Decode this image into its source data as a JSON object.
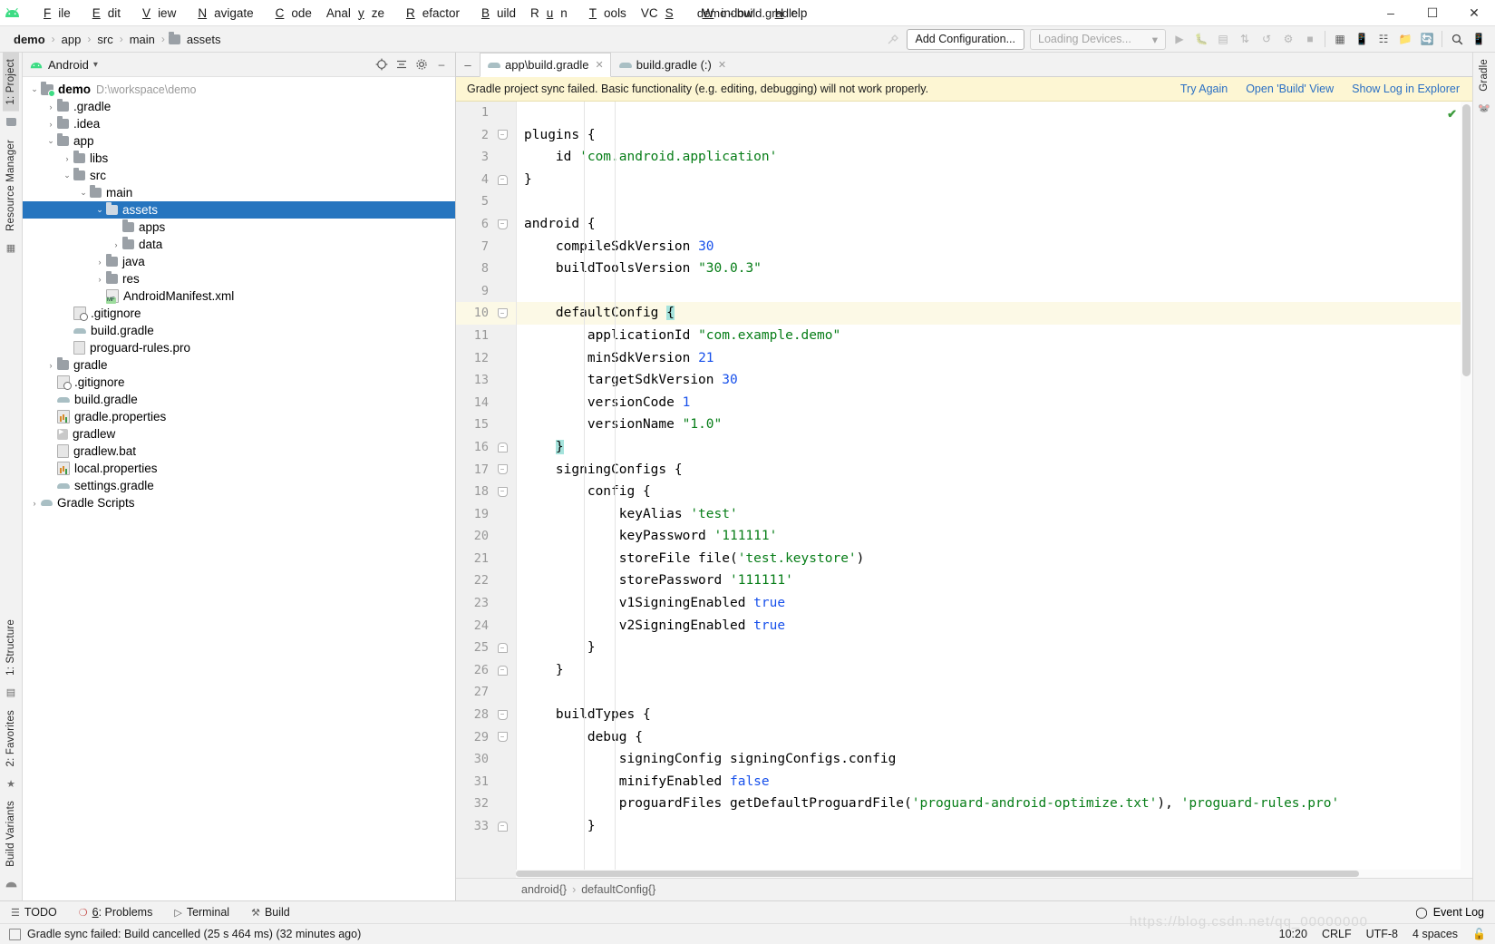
{
  "window": {
    "title": "demo - build.gradle",
    "menu": [
      "File",
      "Edit",
      "View",
      "Navigate",
      "Code",
      "Analyze",
      "Refactor",
      "Build",
      "Run",
      "Tools",
      "VCS",
      "Window",
      "Help"
    ],
    "controls": {
      "minimize": "–",
      "maximize": "☐",
      "close": "✕"
    }
  },
  "breadcrumb": {
    "items": [
      "demo",
      "app",
      "src",
      "main",
      "assets"
    ],
    "separator": "›"
  },
  "toolbar": {
    "add_configuration": "Add Configuration...",
    "devices": "Loading Devices...",
    "devices_caret": "▾"
  },
  "left_rail": {
    "top": [
      "1: Project",
      "Resource Manager"
    ],
    "bottom": [
      "1: Structure",
      "2: Favorites",
      "Build Variants"
    ]
  },
  "project_panel": {
    "title": "Android",
    "caret": "▾",
    "tree": [
      {
        "depth": 0,
        "arrow": "⌄",
        "icon": "module",
        "name": "demo",
        "bold": true,
        "path": "D:\\workspace\\demo",
        "selected": false
      },
      {
        "depth": 1,
        "arrow": "›",
        "icon": "folder",
        "name": ".gradle",
        "selected": false
      },
      {
        "depth": 1,
        "arrow": "›",
        "icon": "folder",
        "name": ".idea",
        "selected": false
      },
      {
        "depth": 1,
        "arrow": "⌄",
        "icon": "folder",
        "name": "app",
        "selected": false
      },
      {
        "depth": 2,
        "arrow": "›",
        "icon": "folder",
        "name": "libs",
        "selected": false
      },
      {
        "depth": 2,
        "arrow": "⌄",
        "icon": "folder",
        "name": "src",
        "selected": false
      },
      {
        "depth": 3,
        "arrow": "⌄",
        "icon": "folder",
        "name": "main",
        "selected": false
      },
      {
        "depth": 4,
        "arrow": "⌄",
        "icon": "folder",
        "name": "assets",
        "selected": true
      },
      {
        "depth": 5,
        "arrow": "",
        "icon": "folder",
        "name": "apps",
        "selected": false
      },
      {
        "depth": 5,
        "arrow": "›",
        "icon": "folder",
        "name": "data",
        "selected": false
      },
      {
        "depth": 4,
        "arrow": "›",
        "icon": "folder",
        "name": "java",
        "selected": false
      },
      {
        "depth": 4,
        "arrow": "›",
        "icon": "folder",
        "name": "res",
        "selected": false
      },
      {
        "depth": 4,
        "arrow": "",
        "icon": "manifest",
        "name": "AndroidManifest.xml",
        "selected": false
      },
      {
        "depth": 2,
        "arrow": "",
        "icon": "gitignore",
        "name": ".gitignore",
        "selected": false
      },
      {
        "depth": 2,
        "arrow": "",
        "icon": "gradle",
        "name": "build.gradle",
        "selected": false
      },
      {
        "depth": 2,
        "arrow": "",
        "icon": "file",
        "name": "proguard-rules.pro",
        "selected": false
      },
      {
        "depth": 1,
        "arrow": "›",
        "icon": "folder",
        "name": "gradle",
        "selected": false
      },
      {
        "depth": 1,
        "arrow": "",
        "icon": "gitignore",
        "name": ".gitignore",
        "selected": false
      },
      {
        "depth": 1,
        "arrow": "",
        "icon": "gradle",
        "name": "build.gradle",
        "selected": false
      },
      {
        "depth": 1,
        "arrow": "",
        "icon": "props",
        "name": "gradle.properties",
        "selected": false
      },
      {
        "depth": 1,
        "arrow": "",
        "icon": "exe",
        "name": "gradlew",
        "selected": false
      },
      {
        "depth": 1,
        "arrow": "",
        "icon": "file",
        "name": "gradlew.bat",
        "selected": false
      },
      {
        "depth": 1,
        "arrow": "",
        "icon": "props",
        "name": "local.properties",
        "selected": false
      },
      {
        "depth": 1,
        "arrow": "",
        "icon": "gradle",
        "name": "settings.gradle",
        "selected": false
      },
      {
        "depth": 0,
        "arrow": "›",
        "icon": "gradlescripts",
        "name": "Gradle Scripts",
        "selected": false
      }
    ]
  },
  "editor": {
    "tabs": [
      {
        "label": "app\\build.gradle",
        "active": true,
        "close": "✕"
      },
      {
        "label": "build.gradle (:)",
        "active": false,
        "close": "✕"
      }
    ],
    "notification": {
      "message": "Gradle project sync failed. Basic functionality (e.g. editing, debugging) will not work properly.",
      "links": [
        "Try Again",
        "Open 'Build' View",
        "Show Log in Explorer"
      ]
    },
    "first_line": 1,
    "highlight_line": 10,
    "lines": [
      {
        "n": 1,
        "text": ""
      },
      {
        "n": 2,
        "text": "plugins {",
        "fold": "open"
      },
      {
        "n": 3,
        "text": "    id 'com.android.application'"
      },
      {
        "n": 4,
        "text": "}",
        "fold": "end"
      },
      {
        "n": 5,
        "text": ""
      },
      {
        "n": 6,
        "text": "android {",
        "fold": "open"
      },
      {
        "n": 7,
        "text": "    compileSdkVersion 30"
      },
      {
        "n": 8,
        "text": "    buildToolsVersion \"30.0.3\""
      },
      {
        "n": 9,
        "text": ""
      },
      {
        "n": 10,
        "text": "    defaultConfig {",
        "fold": "open"
      },
      {
        "n": 11,
        "text": "        applicationId \"com.example.demo\""
      },
      {
        "n": 12,
        "text": "        minSdkVersion 21"
      },
      {
        "n": 13,
        "text": "        targetSdkVersion 30"
      },
      {
        "n": 14,
        "text": "        versionCode 1"
      },
      {
        "n": 15,
        "text": "        versionName \"1.0\""
      },
      {
        "n": 16,
        "text": "    }",
        "fold": "end"
      },
      {
        "n": 17,
        "text": "    signingConfigs {",
        "fold": "open"
      },
      {
        "n": 18,
        "text": "        config {",
        "fold": "open"
      },
      {
        "n": 19,
        "text": "            keyAlias 'test'"
      },
      {
        "n": 20,
        "text": "            keyPassword '111111'"
      },
      {
        "n": 21,
        "text": "            storeFile file('test.keystore')"
      },
      {
        "n": 22,
        "text": "            storePassword '111111'"
      },
      {
        "n": 23,
        "text": "            v1SigningEnabled true"
      },
      {
        "n": 24,
        "text": "            v2SigningEnabled true"
      },
      {
        "n": 25,
        "text": "        }",
        "fold": "end"
      },
      {
        "n": 26,
        "text": "    }",
        "fold": "end"
      },
      {
        "n": 27,
        "text": ""
      },
      {
        "n": 28,
        "text": "    buildTypes {",
        "fold": "open"
      },
      {
        "n": 29,
        "text": "        debug {",
        "fold": "open"
      },
      {
        "n": 30,
        "text": "            signingConfig signingConfigs.config"
      },
      {
        "n": 31,
        "text": "            minifyEnabled false"
      },
      {
        "n": 32,
        "text": "            proguardFiles getDefaultProguardFile('proguard-android-optimize.txt'), 'proguard-rules.pro'"
      },
      {
        "n": 33,
        "text": "        }",
        "fold": "end"
      }
    ],
    "breadcrumb": [
      "android{}",
      "defaultConfig{}"
    ],
    "inspection_ok": "✔"
  },
  "right_rail": {
    "top": [
      "Gradle"
    ]
  },
  "bottom_toolwindows": [
    {
      "icon": "☰",
      "label": "TODO"
    },
    {
      "icon": "❗",
      "label": "6: Problems",
      "mnemonic": "6"
    },
    {
      "icon": "▶",
      "label": "Terminal"
    },
    {
      "icon": "⚒",
      "label": "Build"
    }
  ],
  "status_bar": {
    "message": "Gradle sync failed: Build cancelled (25 s 464 ms) (32 minutes ago)",
    "event_log": "Event Log",
    "caret": "10:20",
    "line_separator": "CRLF",
    "encoding": "UTF-8",
    "indent": "4 spaces",
    "lock_icon": "🔓"
  },
  "colors": {
    "selection": "#2675bf",
    "notification_bg": "#fdf6d3",
    "link": "#2a6fc4",
    "string": "#067d17",
    "number": "#1750eb",
    "highlight_line": "#fcf9e6"
  }
}
